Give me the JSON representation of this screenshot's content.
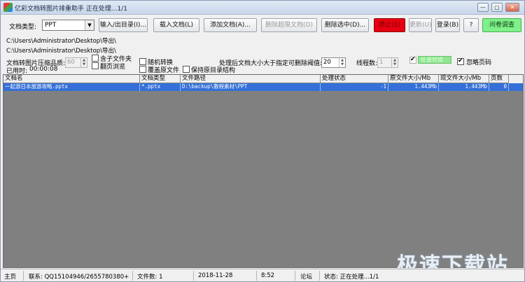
{
  "window": {
    "title": "亿彩文档转图片排重助手  正在处理...1/1",
    "controls": {
      "minimize": "—",
      "maximize": "▢",
      "close": "✕"
    }
  },
  "toolbar": {
    "doc_type_label": "文档类型:",
    "doc_type_value": "PPT",
    "input_output_dir": "输入/出目录(I)...",
    "load_doc": "载入文档(L)",
    "add_doc": "添加文档(A)...",
    "delete_selected_docs": "删除超限文档(D)",
    "delete_selected": "删除选中(D)...",
    "stop": "停止(S)",
    "update": "更新(U)",
    "login": "登录(B)",
    "help": "?",
    "survey": "问卷调查"
  },
  "paths": {
    "input": "C:\\Users\\Administrator\\Desktop\\导出\\",
    "output": "C:\\Users\\Administrator\\Desktop\\导出\\"
  },
  "options": {
    "quality_label": "文档转图片压缩品质:",
    "quality_value": "60",
    "elapsed_label": "已用时:",
    "elapsed_value": "00:00:08",
    "include_subfolders": "含子文件夹",
    "flip_preview": "翻页浏览",
    "random_convert": "随机转换",
    "overwrite_original": "覆盖原文件",
    "keep_dir_structure": "保持原目录结构",
    "threshold_label": "处理后文档大小大于指定可删除阈值:",
    "threshold_value": "20",
    "threads_label": "线程数:",
    "threads_value": "1",
    "batch_convert": "批量转换",
    "ignore_page_count": "忽略页码"
  },
  "table": {
    "columns": [
      "文档名",
      "文档类型",
      "文件路径",
      "处理状态",
      "原文件大小/Mb",
      "现文件大小/Mb",
      "页数"
    ],
    "rows": [
      [
        "一起游日本旅游攻略.pptx",
        "*.pptx",
        "D:\\backup\\教程素材\\PPT",
        "-1",
        "1.443Mb",
        "1.443Mb",
        "0"
      ]
    ]
  },
  "statusbar": {
    "home": "主页",
    "contact": "联系: QQ15104946/2655780380+",
    "file_count": "文件数: 1",
    "date": "2018-11-28",
    "time": "8:52",
    "forum": "论坛",
    "status": "状态:  正在处理...1/1"
  },
  "watermark": "极速下载站",
  "colors": {
    "selected_row": "#3470d8",
    "stop_button": "#e60012",
    "survey_button": "#7ff08a"
  }
}
